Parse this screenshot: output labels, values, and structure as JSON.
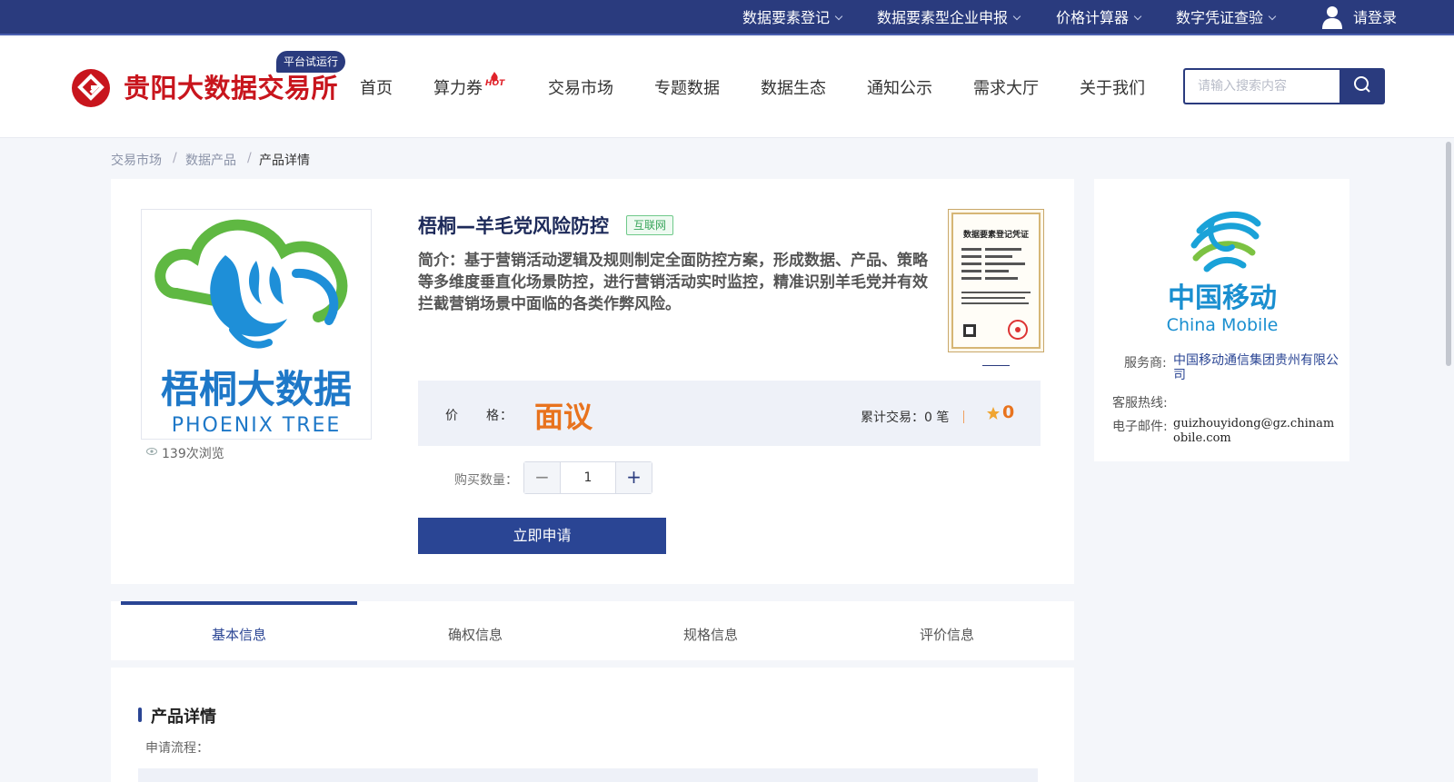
{
  "topbar": {
    "links": [
      "数据要素登记",
      "数据要素型企业申报",
      "价格计算器",
      "数字凭证查验"
    ],
    "login": "请登录"
  },
  "header": {
    "logo_text": "贵阳大数据交易所",
    "beta_badge": "平台试运行",
    "nav": [
      "首页",
      "算力券",
      "交易市场",
      "专题数据",
      "数据生态",
      "通知公示",
      "需求大厅",
      "关于我们"
    ],
    "hot_label": "HOT",
    "search_placeholder": "请输入搜索内容"
  },
  "breadcrumb": [
    "交易市场",
    "数据产品",
    "产品详情"
  ],
  "product": {
    "title": "梧桐—羊毛党风险防控",
    "tag": "互联网",
    "intro": "简介：基于营销活动逻辑及规则制定全面防控方案，形成数据、产品、策略等多维度垂直化场景防控，进行营销活动实时监控，精准识别羊毛党并有效拦截营销场景中面临的各类作弊风险。",
    "image_text_cn": "梧桐大数据",
    "image_text_en": "PHOENIX TREE",
    "views": "139次浏览",
    "certificate_title": "数据要素登记凭证",
    "price_label": "价　　格：",
    "price_value": "面议",
    "trades": "累计交易：0 笔",
    "rating": "0",
    "qty_label": "购买数量：",
    "qty_value": "1",
    "apply_label": "立即申请"
  },
  "provider": {
    "logo_cn": "中国移动",
    "logo_en": "China Mobile",
    "service_label": "服务商:",
    "service_value": "中国移动通信集团贵州有限公司",
    "hotline_label": "客服热线:",
    "hotline_value": "",
    "email_label": "电子邮件:",
    "email_value": "guizhouyidong@gz.chinamobile.com"
  },
  "tabs": [
    "基本信息",
    "确权信息",
    "规格信息",
    "评价信息"
  ],
  "detail": {
    "section_title": "产品详情",
    "sub_label": "申请流程："
  },
  "colors": {
    "primary": "#2a3b7e",
    "accent_orange": "#e8731e",
    "logo_red": "#c8151d"
  }
}
